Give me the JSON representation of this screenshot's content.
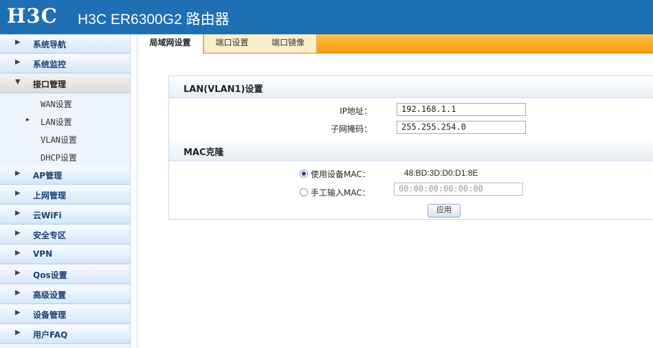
{
  "header": {
    "logo": "H3C",
    "title": "H3C ER6300G2 路由器"
  },
  "sidebar": {
    "items_top": [
      {
        "label": "系统导航"
      },
      {
        "label": "系统监控"
      }
    ],
    "open_item": {
      "label": "接口管理"
    },
    "sub_items": [
      {
        "label": "WAN设置"
      },
      {
        "label": "LAN设置"
      },
      {
        "label": "VLAN设置"
      },
      {
        "label": "DHCP设置"
      }
    ],
    "items_bottom": [
      {
        "label": "AP管理"
      },
      {
        "label": "上网管理"
      },
      {
        "label": "云WiFi"
      },
      {
        "label": "安全专区"
      },
      {
        "label": "VPN"
      },
      {
        "label": "Qos设置"
      },
      {
        "label": "高级设置"
      },
      {
        "label": "设备管理"
      },
      {
        "label": "用户FAQ"
      }
    ],
    "arrow_glyph": "▶",
    "open_arrow_glyph": "▼",
    "selected_marker": "▸"
  },
  "tabs": [
    {
      "label": "局域网设置"
    },
    {
      "label": "端口设置"
    },
    {
      "label": "端口镜像"
    }
  ],
  "lan_section": {
    "title": "LAN(VLAN1)设置",
    "ip_label": "IP地址：",
    "ip_value": "192.168.1.1",
    "mask_label": "子网掩码：",
    "mask_value": "255.255.254.0"
  },
  "mac_section": {
    "title": "MAC克隆",
    "use_device_label": "使用设备MAC：",
    "device_mac": "48:BD:3D:D0:D1:8E",
    "manual_label": "手工输入MAC：",
    "manual_placeholder": "00:00:00:00:00:00",
    "selected_option": "use_device"
  },
  "apply_label": "应用",
  "colors": {
    "header": "#1f6fb4",
    "tab_bar": "#f59b12",
    "accent_text": "#1c3f73"
  }
}
